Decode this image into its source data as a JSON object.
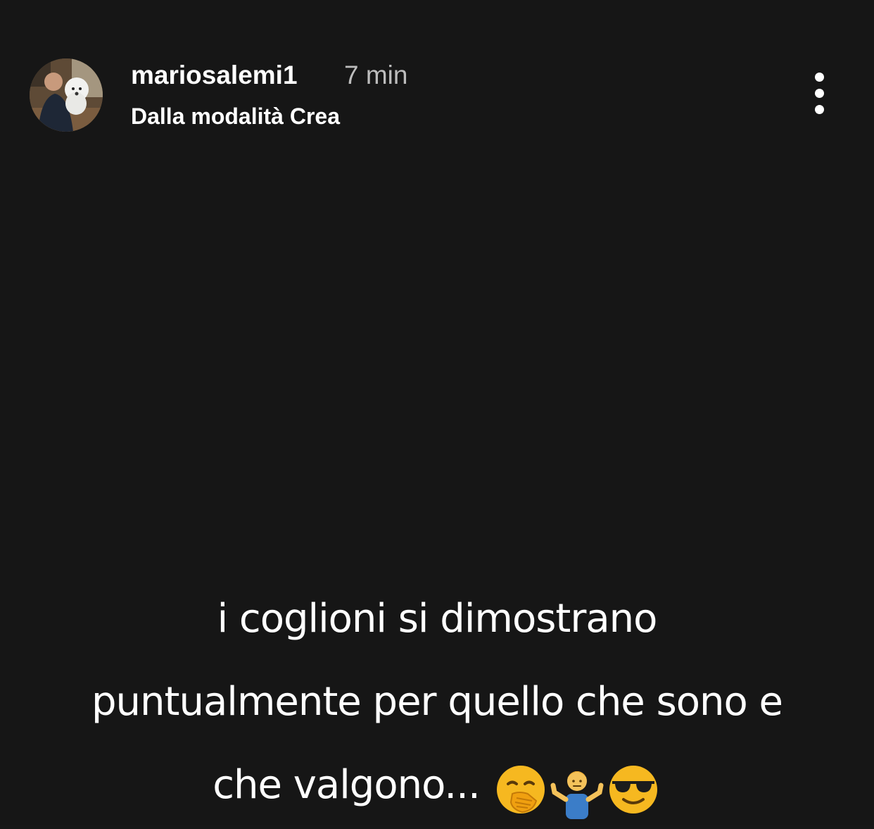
{
  "story": {
    "author": {
      "username": "mariosalemi1",
      "time_ago": "7 min",
      "source_label": "Dalla modalità Crea",
      "avatar_icon": "profile-photo-avatar"
    },
    "menu_icon": "more-vertical-icon",
    "caption": {
      "line1": "i coglioni si dimostrano",
      "line2": "puntualmente per quello che sono e",
      "line3": "che valgono...",
      "emojis": [
        "face-with-hand-over-mouth",
        "man-shrugging",
        "smiling-face-with-sunglasses"
      ]
    },
    "colors": {
      "background": "#161616",
      "text": "#ffffff",
      "muted_text": "#bdbdbd"
    }
  }
}
